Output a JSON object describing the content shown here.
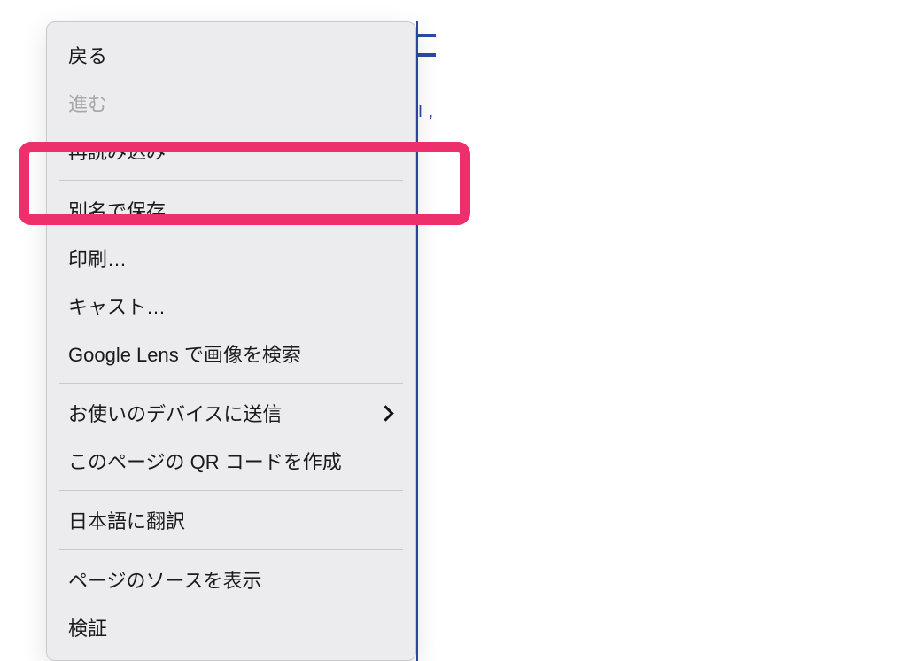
{
  "menu": {
    "back": "戻る",
    "forward": "進む",
    "reload": "再読み込み",
    "save_as": "別名で保存…",
    "print": "印刷…",
    "cast": "キャスト…",
    "google_lens": "Google Lens で画像を検索",
    "send_to_device": "お使いのデバイスに送信",
    "create_qr": "このページの QR コードを作成",
    "translate": "日本語に翻訳",
    "view_source": "ページのソースを表示",
    "inspect": "検証"
  },
  "background": {
    "edge_fragment": "I ,"
  },
  "highlight": {
    "color": "#ed2f6c"
  }
}
